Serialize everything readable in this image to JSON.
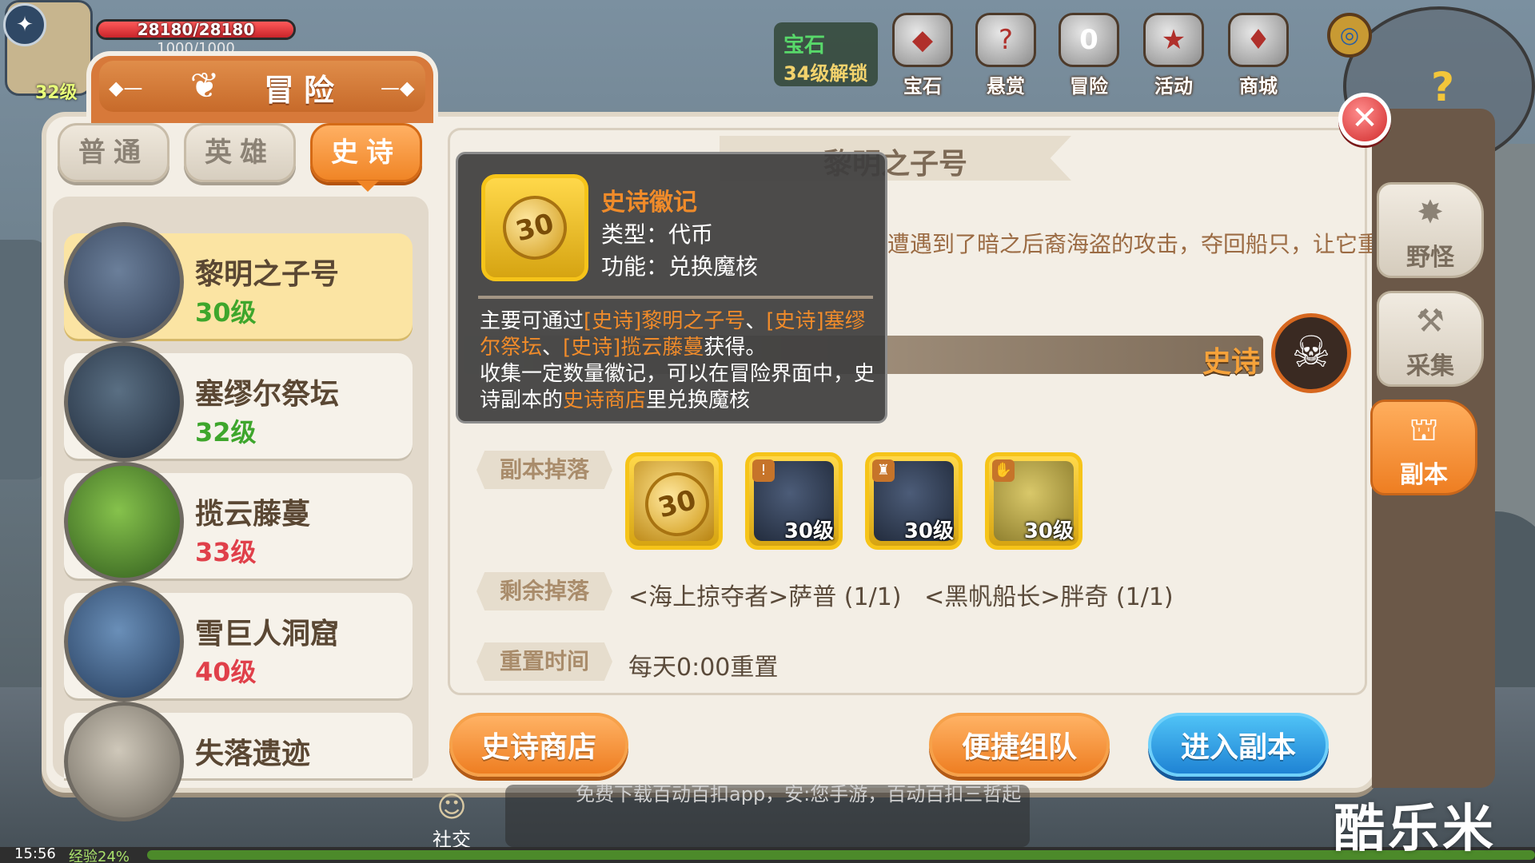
{
  "hud": {
    "hp_text": "28180/28180",
    "hp_fraction": 1.0,
    "mp_text": "1000/1000",
    "level": "32级",
    "clock": "15:56",
    "exp_text": "经验24%",
    "exp_fraction": 0.24
  },
  "topmenu": {
    "gem_lock_title": "宝石",
    "gem_lock_sub": "34级解锁",
    "items": [
      {
        "label": "宝石",
        "icon": "gem-icon"
      },
      {
        "label": "悬赏",
        "icon": "bounty-icon"
      },
      {
        "label": "冒险",
        "icon": "adventure-icon",
        "badge": "0"
      },
      {
        "label": "活动",
        "icon": "event-icon"
      },
      {
        "label": "商城",
        "icon": "shop-icon"
      }
    ]
  },
  "panel": {
    "title": "冒险",
    "tabs": [
      "普通",
      "英雄",
      "史诗"
    ],
    "active_tab": 2
  },
  "dungeons": [
    {
      "name": "黎明之子号",
      "level": "30级",
      "level_color": "#3ea62c",
      "selected": true
    },
    {
      "name": "塞缪尔祭坛",
      "level": "32级",
      "level_color": "#3ea62c"
    },
    {
      "name": "揽云藤蔓",
      "level": "33级",
      "level_color": "#e0404a"
    },
    {
      "name": "雪巨人洞窟",
      "level": "40级",
      "level_color": "#e0404a"
    },
    {
      "name": "失落遗迹",
      "level": ""
    }
  ],
  "detail": {
    "title": "黎明之子号",
    "description": "遭遇到了暗之后裔海盗的攻击，夺回船只，让它重新起航",
    "difficulty": "史诗",
    "drops_label": "副本掉落",
    "drops": [
      {
        "type": "coin",
        "coin_value": "30",
        "level": ""
      },
      {
        "type": "hat",
        "level": "30级"
      },
      {
        "type": "hat",
        "level": "30级"
      },
      {
        "type": "shark",
        "level": "30级"
      }
    ],
    "remaining_label": "剩余掉落",
    "remaining_value": "<海上掠夺者>萨普 (1/1)   <黑帆船长>胖奇 (1/1)",
    "reset_label": "重置时间",
    "reset_value": "每天0:00重置"
  },
  "tooltip": {
    "name": "史诗徽记",
    "coin_value": "30",
    "type": "类型：代币",
    "function": "功能：兑换魔核",
    "desc_1": "主要可通过",
    "desc_link_1": "[史诗]黎明之子号",
    "desc_2": "、",
    "desc_link_2": "[史诗]塞缪尔祭坛",
    "desc_3": "、",
    "desc_link_3": "[史诗]揽云藤蔓",
    "desc_4": "获得。",
    "desc_5": "收集一定数量徽记，可以在冒险界面中，史诗副本的",
    "desc_link_4": "史诗商店",
    "desc_6": "里兑换魔核"
  },
  "buttons": {
    "shop": "史诗商店",
    "team": "便捷组队",
    "enter": "进入副本"
  },
  "side_tabs": [
    {
      "label": "野怪",
      "icon": "monster-icon"
    },
    {
      "label": "采集",
      "icon": "pickaxe-icon"
    },
    {
      "label": "副本",
      "icon": "dungeon-icon",
      "active": true
    }
  ],
  "bottom": {
    "social": "社交",
    "chat": "免费下载百动百扣app，安:您手游，百动百扣三哲起",
    "watermark": "酷乐米"
  },
  "colors": {
    "accent_orange": "#f08526",
    "enter_blue": "#1f83d4",
    "level_green": "#3ea62c",
    "level_red": "#e0404a"
  }
}
